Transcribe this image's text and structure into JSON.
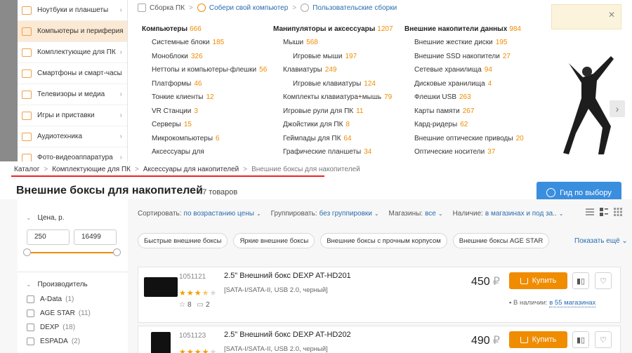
{
  "left_menu": {
    "items": [
      {
        "label": "Ноутбуки и планшеты",
        "icon": "laptop-icon"
      },
      {
        "label": "Компьютеры и периферия",
        "icon": "computer-icon",
        "active": true
      },
      {
        "label": "Комплектующие для ПК",
        "icon": "chip-icon"
      },
      {
        "label": "Смартфоны и смарт-часы",
        "icon": "smartphone-icon"
      },
      {
        "label": "Телевизоры и медиа",
        "icon": "tv-icon"
      },
      {
        "label": "Игры и приставки",
        "icon": "gamepad-icon"
      },
      {
        "label": "Аудиотехника",
        "icon": "speaker-icon"
      },
      {
        "label": "Фото-видеоаппаратура",
        "icon": "camera-icon"
      }
    ]
  },
  "mega_menu": {
    "crumbs": {
      "build": "Сборка ПК",
      "build_your_own": "Собери свой компьютер",
      "user_builds": "Пользовательские сборки"
    },
    "columns": [
      {
        "title": "Компьютеры",
        "count": "666",
        "rows": [
          {
            "label": "Системные блоки",
            "count": "185"
          },
          {
            "label": "Моноблоки",
            "count": "326"
          },
          {
            "label": "Неттопы и компьютеры-флешки",
            "count": "56"
          },
          {
            "label": "Платформы",
            "count": "46"
          },
          {
            "label": "Тонкие клиенты",
            "count": "12"
          },
          {
            "label": "VR Станции",
            "count": "3"
          },
          {
            "label": "Серверы",
            "count": "15"
          },
          {
            "label": "Микрокомпьютеры",
            "count": "6"
          },
          {
            "label": "Аксессуары для",
            "count": ""
          }
        ]
      },
      {
        "title": "Манипуляторы и аксессуары",
        "count": "1207",
        "rows": [
          {
            "label": "Мыши",
            "count": "568"
          },
          {
            "label": "Игровые мыши",
            "count": "197",
            "sub": true
          },
          {
            "label": "Клавиатуры",
            "count": "249"
          },
          {
            "label": "Игровые клавиатуры",
            "count": "124",
            "sub": true
          },
          {
            "label": "Комплекты клавиатура+мышь",
            "count": "79"
          },
          {
            "label": "Игровые рули для ПК",
            "count": "11"
          },
          {
            "label": "Джойстики для ПК",
            "count": "8"
          },
          {
            "label": "Геймпады для ПК",
            "count": "64"
          },
          {
            "label": "Графические планшеты",
            "count": "34"
          }
        ]
      },
      {
        "title": "Внешние накопители данных",
        "count": "984",
        "rows": [
          {
            "label": "Внешние жесткие диски",
            "count": "195"
          },
          {
            "label": "Внешние SSD накопители",
            "count": "27"
          },
          {
            "label": "Сетевые хранилища",
            "count": "94"
          },
          {
            "label": "Дисковые хранилища",
            "count": "4"
          },
          {
            "label": "Флешки USB",
            "count": "263"
          },
          {
            "label": "Карты памяти",
            "count": "267"
          },
          {
            "label": "Кард-ридеры",
            "count": "62"
          },
          {
            "label": "Внешние оптические приводы",
            "count": "20"
          },
          {
            "label": "Оптические носители",
            "count": "37"
          }
        ]
      }
    ]
  },
  "breadcrumbs": [
    "Каталог",
    "Комплектующие для ПК",
    "Аксессуары для накопителей",
    "Внешние боксы для накопителей"
  ],
  "page": {
    "title": "Внешние боксы для накопителей",
    "count": "47 товаров",
    "guide_button": "Гид по выбору"
  },
  "filters": {
    "price_title": "Цена, р.",
    "price_min": "250",
    "price_max": "16499",
    "manufacturer_title": "Производитель",
    "manufacturers": [
      {
        "name": "A-Data",
        "count": "(1)"
      },
      {
        "name": "AGE STAR",
        "count": "(11)"
      },
      {
        "name": "DEXP",
        "count": "(18)"
      },
      {
        "name": "ESPADA",
        "count": "(2)"
      }
    ]
  },
  "toolbar": {
    "sort_label": "Сортировать:",
    "sort_value": "по возрастанию цены",
    "group_label": "Группировать:",
    "group_value": "без группировки",
    "shops_label": "Магазины:",
    "shops_value": "все",
    "avail_label": "Наличие:",
    "avail_value": "в магазинах и под за.."
  },
  "chips": [
    "Быстрые внешние боксы",
    "Яркие внешние боксы",
    "Внешние боксы с прочным корпусом",
    "Внешние боксы AGE STAR"
  ],
  "show_more": "Показать ещё",
  "products": [
    {
      "code": "1051121",
      "name": "2.5\" Внешний бокс DEXP AT-HD201",
      "spec": "[SATA-I/SATA-II, USB 2.0, черный]",
      "rating": 3.5,
      "reviews": "8",
      "comments": "2",
      "price": "450",
      "currency": "₽",
      "buy": "Купить",
      "avail_prefix": "В наличии:",
      "avail_link": "в 55 магазинах"
    },
    {
      "code": "1051123",
      "name": "2.5\" Внешний бокс DEXP AT-HD202",
      "spec": "[SATA-I/SATA-II, USB 2.0, черный]",
      "rating": 4,
      "price": "490",
      "currency": "₽",
      "buy": "Купить"
    }
  ],
  "colors": {
    "accent_orange": "#f08c00",
    "link_blue": "#2a6cb0",
    "guide_blue": "#3a8ede"
  }
}
